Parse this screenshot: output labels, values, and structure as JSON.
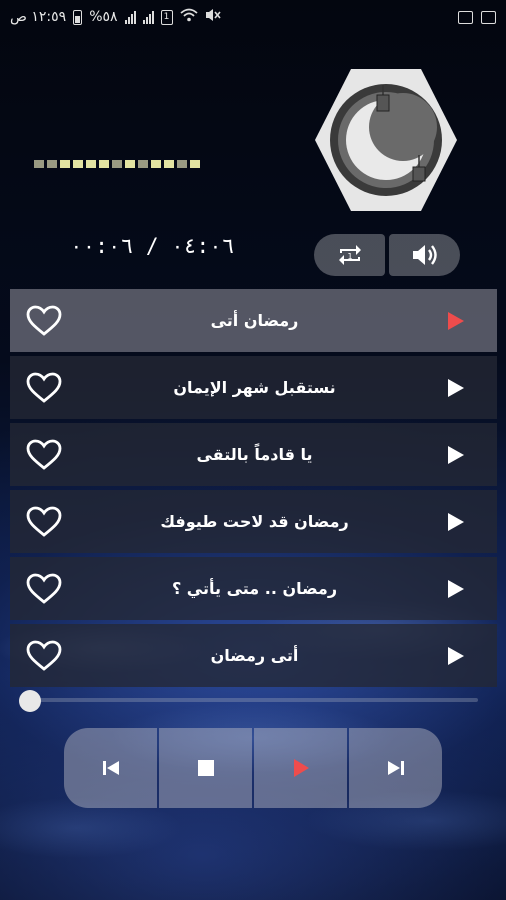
{
  "status_bar": {
    "time": "١٢:٥٩ ص",
    "battery": "%٥٨",
    "sim_slot": "1"
  },
  "player": {
    "time_display": "٠٤:٠٦ / ٠٠:٠٦",
    "progress": 0.02,
    "eq_levels": [
      0.6,
      0.6,
      1,
      1,
      1,
      1,
      0.6,
      1,
      0.6,
      1,
      1,
      0.6,
      1
    ],
    "colors": {
      "active_play": "#ee4c4c",
      "eq": "#e3e3a2",
      "row": "#242834",
      "active_row": "#96969f"
    }
  },
  "buttons": {
    "repeat_icon": "repeat-one-icon",
    "volume_icon": "volume-icon",
    "prev_icon": "skip-previous-icon",
    "stop_icon": "stop-icon",
    "play_icon": "play-icon",
    "next_icon": "skip-next-icon"
  },
  "tracks": [
    {
      "title": "رمضان أتى",
      "active": true
    },
    {
      "title": "نستقبل شهر الإيمان",
      "active": false
    },
    {
      "title": "يا قادماً بالتقى",
      "active": false
    },
    {
      "title": "رمضان قد لاحت طيوفك",
      "active": false
    },
    {
      "title": "رمضان .. متى يأتي ؟",
      "active": false
    },
    {
      "title": "أتى رمضان",
      "active": false
    }
  ]
}
